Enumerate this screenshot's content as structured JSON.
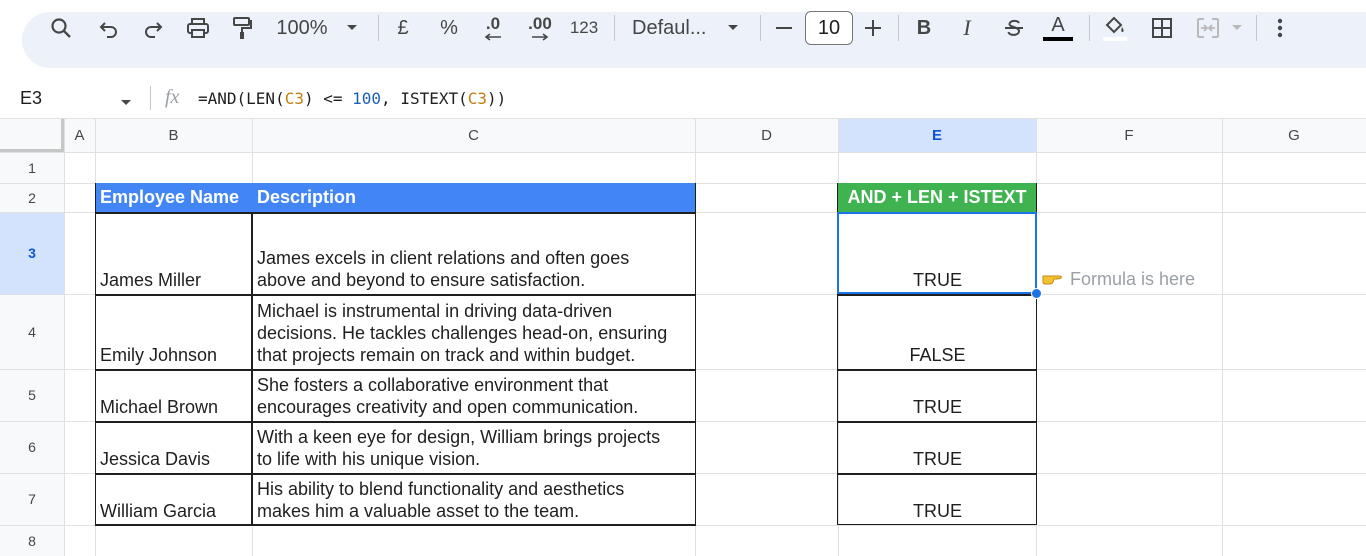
{
  "toolbar": {
    "zoom": "100%",
    "currency": "£",
    "percent": "%",
    "decrease_decimal": ".0",
    "increase_decimal": ".00",
    "number_format": "123",
    "font": "Defaul...",
    "font_size": "10",
    "bold": "B",
    "italic": "I",
    "text_color_letter": "A"
  },
  "formula_bar": {
    "name_box": "E3",
    "fx": "fx",
    "formula_parts": [
      "=AND(LEN(",
      "C3",
      ") <= ",
      "100",
      ", ISTEXT(",
      "C3",
      "))"
    ]
  },
  "columns": [
    "A",
    "B",
    "C",
    "D",
    "E",
    "F",
    "G"
  ],
  "rows": [
    "1",
    "2",
    "3",
    "4",
    "5",
    "6",
    "7",
    "8"
  ],
  "table": {
    "headers": [
      "Employee Name",
      "Description"
    ],
    "header_color": "#4285f4",
    "rows": [
      {
        "name": "James Miller",
        "desc": [
          "James excels in client relations and often goes",
          "above and beyond to ensure satisfaction."
        ]
      },
      {
        "name": "Emily Johnson",
        "desc": [
          "Michael is instrumental in driving data-driven",
          "decisions. He tackles challenges head-on, ensuring",
          "that projects remain on track and within budget."
        ]
      },
      {
        "name": "Michael Brown",
        "desc": [
          "She fosters a collaborative environment that",
          "encourages creativity and open communication."
        ]
      },
      {
        "name": "Jessica Davis",
        "desc": [
          "With a keen eye for design, William brings projects",
          "to life with his unique vision."
        ]
      },
      {
        "name": "William Garcia",
        "desc": [
          "His ability to blend functionality and aesthetics",
          "makes him a valuable asset to the team."
        ]
      }
    ]
  },
  "result": {
    "header": "AND + LEN + ISTEXT",
    "header_color": "#3fb34f",
    "values": [
      "TRUE",
      "FALSE",
      "TRUE",
      "TRUE",
      "TRUE"
    ]
  },
  "annotation": "Formula is here",
  "selection_color": "#1a73e8"
}
